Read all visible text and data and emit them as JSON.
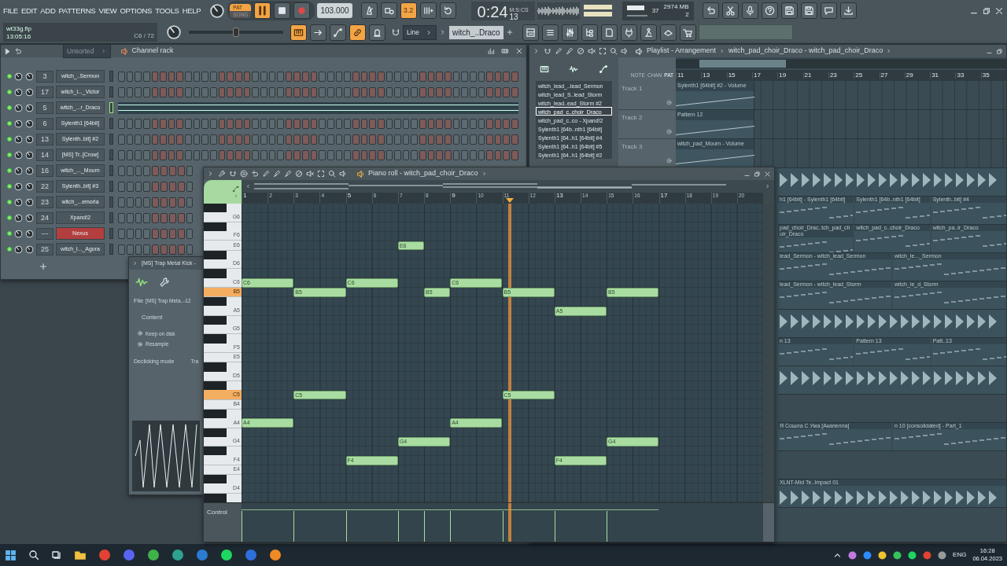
{
  "menu": [
    "FILE",
    "EDIT",
    "ADD",
    "PATTERNS",
    "VIEW",
    "OPTIONS",
    "TOOLS",
    "HELP"
  ],
  "project": {
    "file": "wt33g.flp",
    "time": "13:05:16",
    "note": "C6 / 72"
  },
  "mode": [
    {
      "label": "PAT",
      "selected": true
    },
    {
      "label": "SONG",
      "selected": false
    }
  ],
  "tempo": "103.000",
  "record_options": [
    {
      "kind": "metronome",
      "on": false
    },
    {
      "kind": "wait",
      "on": false
    },
    {
      "kind": "countdown",
      "label": "3.2",
      "on": true
    },
    {
      "kind": "step",
      "on": false
    },
    {
      "kind": "loop",
      "on": false
    }
  ],
  "time": {
    "value": "0:24",
    "centiseconds": "13",
    "unit": "M:S:CS"
  },
  "monitor": {
    "cpu": "37",
    "memory": "2974 MB",
    "voices": "2"
  },
  "master_pitch": {
    "level": 0.5
  },
  "edit_options": [
    {
      "kind": "keyboard",
      "on": true
    },
    {
      "kind": "arrow",
      "on": false
    },
    {
      "kind": "curve",
      "on": false
    },
    {
      "kind": "link",
      "on": true
    },
    {
      "kind": "bell",
      "on": false
    }
  ],
  "snap": "Line",
  "pattern": "witch_..Draco",
  "channel_rack": {
    "title": "Channel rack",
    "filter": "Unsorted",
    "channels": [
      {
        "number": "3",
        "name": "witch_..Sermon",
        "kind": "steps",
        "selected": false,
        "color": "#4b575d"
      },
      {
        "number": "17",
        "name": "witch_l..._Victor",
        "kind": "steps",
        "selected": false,
        "color": "#4b575d"
      },
      {
        "number": "5",
        "name": "witch_...r_Draco",
        "kind": "pianoroll",
        "selected": true,
        "color": "#4b575d"
      },
      {
        "number": "6",
        "name": "Sylenth1 [64bit]",
        "kind": "steps",
        "selected": false,
        "color": "#4b575d"
      },
      {
        "number": "13",
        "name": "Sylenth..bit] #2",
        "kind": "steps",
        "selected": false,
        "color": "#4b575d"
      },
      {
        "number": "14",
        "name": "[MS] Tr..[Crow]",
        "kind": "steps",
        "selected": false,
        "color": "#4b575d"
      },
      {
        "number": "16",
        "name": "witch_..._Mourn",
        "kind": "steps",
        "selected": false,
        "color": "#4b575d"
      },
      {
        "number": "22",
        "name": "Sylenth..bit] #3",
        "kind": "steps",
        "selected": false,
        "color": "#4b575d"
      },
      {
        "number": "23",
        "name": "witch_...emoria",
        "kind": "steps",
        "selected": false,
        "color": "#4b575d"
      },
      {
        "number": "24",
        "name": "Xpand!2",
        "kind": "steps",
        "selected": false,
        "color": "#4b575d"
      },
      {
        "number": "---",
        "name": "Nexus",
        "kind": "steps",
        "selected": false,
        "color": "#b23e3e"
      },
      {
        "number": "25",
        "name": "witch_l..._Agora",
        "kind": "steps",
        "selected": false,
        "color": "#4b575d"
      }
    ]
  },
  "sampler": {
    "title": "[MS] Trap Metal Kick -",
    "file_label": "File",
    "file": "[MS] Trap Meta..-12",
    "section": "Content",
    "options": [
      "Keep on disk",
      "Resample"
    ],
    "declick_label": "Declicking mode",
    "declick": "Tra"
  },
  "piano_roll": {
    "title": "Piano roll - witch_pad_choir_Draco",
    "ruler": [
      "1",
      "2",
      "3",
      "4",
      "5",
      "6",
      "7",
      "8",
      "9",
      "10",
      "11",
      "12",
      "13",
      "14",
      "15",
      "16",
      "17",
      "18",
      "19",
      "20"
    ],
    "playhead": {
      "level": 0.515
    },
    "keys": [
      {
        "label": "G6",
        "highlighted": false
      },
      {
        "label": "F6",
        "highlighted": false
      },
      {
        "label": "E6",
        "highlighted": false
      },
      {
        "label": "D6",
        "highlighted": false
      },
      {
        "label": "C6",
        "highlighted": false
      },
      {
        "label": "B5",
        "highlighted": true
      },
      {
        "label": "A5",
        "highlighted": false
      },
      {
        "label": "G5",
        "highlighted": false
      },
      {
        "label": "F5",
        "highlighted": false
      },
      {
        "label": "E5",
        "highlighted": false
      },
      {
        "label": "D5",
        "highlighted": false
      },
      {
        "label": "C5",
        "highlighted": true
      },
      {
        "label": "B4",
        "highlighted": false
      },
      {
        "label": "A4",
        "highlighted": false
      },
      {
        "label": "G4",
        "highlighted": false
      },
      {
        "label": "F4",
        "highlighted": false
      },
      {
        "label": "E4",
        "highlighted": false
      },
      {
        "label": "D4",
        "highlighted": false
      }
    ],
    "voices": [
      {
        "notes": [
          {
            "pitch": "C6",
            "kind": "long"
          },
          {
            "pitch": "B5",
            "kind": "long"
          },
          {
            "pitch": "C6",
            "kind": "long"
          },
          {
            "pitch": "E6",
            "kind": "short"
          },
          {
            "pitch": "B5",
            "kind": "short"
          },
          {
            "pitch": "C6",
            "kind": "long"
          },
          {
            "pitch": "B5",
            "kind": "long"
          },
          {
            "pitch": "A5",
            "kind": "long"
          },
          {
            "pitch": "B5",
            "kind": "long"
          }
        ]
      },
      {
        "notes": [
          {
            "pitch": "A4",
            "kind": "long"
          },
          {
            "pitch": "C5",
            "kind": "long"
          },
          {
            "pitch": "F4",
            "kind": "long"
          },
          {
            "pitch": "G4",
            "kind": "long"
          },
          {
            "pitch": "A4",
            "kind": "long"
          },
          {
            "pitch": "C5",
            "kind": "long"
          },
          {
            "pitch": "F4",
            "kind": "long"
          },
          {
            "pitch": "G4",
            "kind": "long"
          }
        ]
      }
    ],
    "control_label": "Control"
  },
  "playlist": {
    "title": "Playlist - Arrangement",
    "crumb": "witch_pad_choir_Draco - witch_pad_choir_Draco",
    "filters": [
      {
        "label": "NOTE",
        "selected": false
      },
      {
        "label": "CHAN",
        "selected": false
      },
      {
        "label": "PAT",
        "selected": true
      }
    ],
    "patterns": [
      {
        "name": "witch_lead_..lead_Sermon",
        "selected": false
      },
      {
        "name": "witch_lead_S..lead_Storm",
        "selected": false
      },
      {
        "name": "witch_lead..ead_Storm #2",
        "selected": false
      },
      {
        "name": "witch_pad_c..choir_Draco",
        "selected": true
      },
      {
        "name": "witch_pad_c..co - Xpand!2",
        "selected": false
      },
      {
        "name": "Sylenth1 [64b..nth1 [64bit]",
        "selected": false
      },
      {
        "name": "Sylenth1 [64..h1 [64bit] #4",
        "selected": false
      },
      {
        "name": "Sylenth1 [64..h1 [64bit] #5",
        "selected": false
      },
      {
        "name": "Sylenth1 [64..h1 [64bit] #2",
        "selected": false
      }
    ],
    "ruler": [
      "11",
      "13",
      "15",
      "17",
      "19",
      "21",
      "23",
      "25",
      "27",
      "29",
      "31",
      "33",
      "35"
    ],
    "tracks": [
      {
        "name": "Track 1",
        "clip": "Sylenth1 [64bit] #2 - Volume"
      },
      {
        "name": "Track 2",
        "clip": "Pattern 12"
      },
      {
        "name": "Track 3",
        "clip": "witch_pad_Mourn - Volume"
      }
    ],
    "lanes": [
      {
        "kind": "audio"
      },
      {
        "kind": "pattern",
        "clips": [
          "h1 [64bit] - Sylenth1 [64bit]",
          "Sylenth1 [64b..nth1 [64bit]",
          "Sylenth..bit] #4"
        ]
      },
      {
        "kind": "pattern",
        "clips": [
          "pad_choir_Drac..tch_pad_choir_Draco",
          "witch_pad_c..choir_Draco",
          "witch_pa..ir_Draco"
        ]
      },
      {
        "kind": "pattern",
        "clips": [
          "lead_Sermon - witch_lead_Sermon",
          "witch_le..._Sermon"
        ]
      },
      {
        "kind": "pattern",
        "clips": [
          "lead_Sermon - witch_lead_Storm",
          "witch_le_d_Storm"
        ]
      },
      {
        "kind": "audio"
      },
      {
        "kind": "pattern",
        "clips": [
          "n 13",
          "Pattern 13",
          "Patt..13"
        ]
      },
      {
        "kind": "audio"
      },
      {
        "kind": "empty"
      },
      {
        "kind": "pattern",
        "clips": [
          "Я Сошла С Ума [Акапелла]",
          "n 10 [consolidated] - Part_1"
        ]
      },
      {
        "kind": "empty"
      },
      {
        "kind": "audio",
        "clips": [
          "XLNT-Mid Te..Impact 01"
        ]
      }
    ]
  },
  "taskbar": {
    "language": "ENG",
    "time": "16:28",
    "date": "06.04.2023"
  }
}
